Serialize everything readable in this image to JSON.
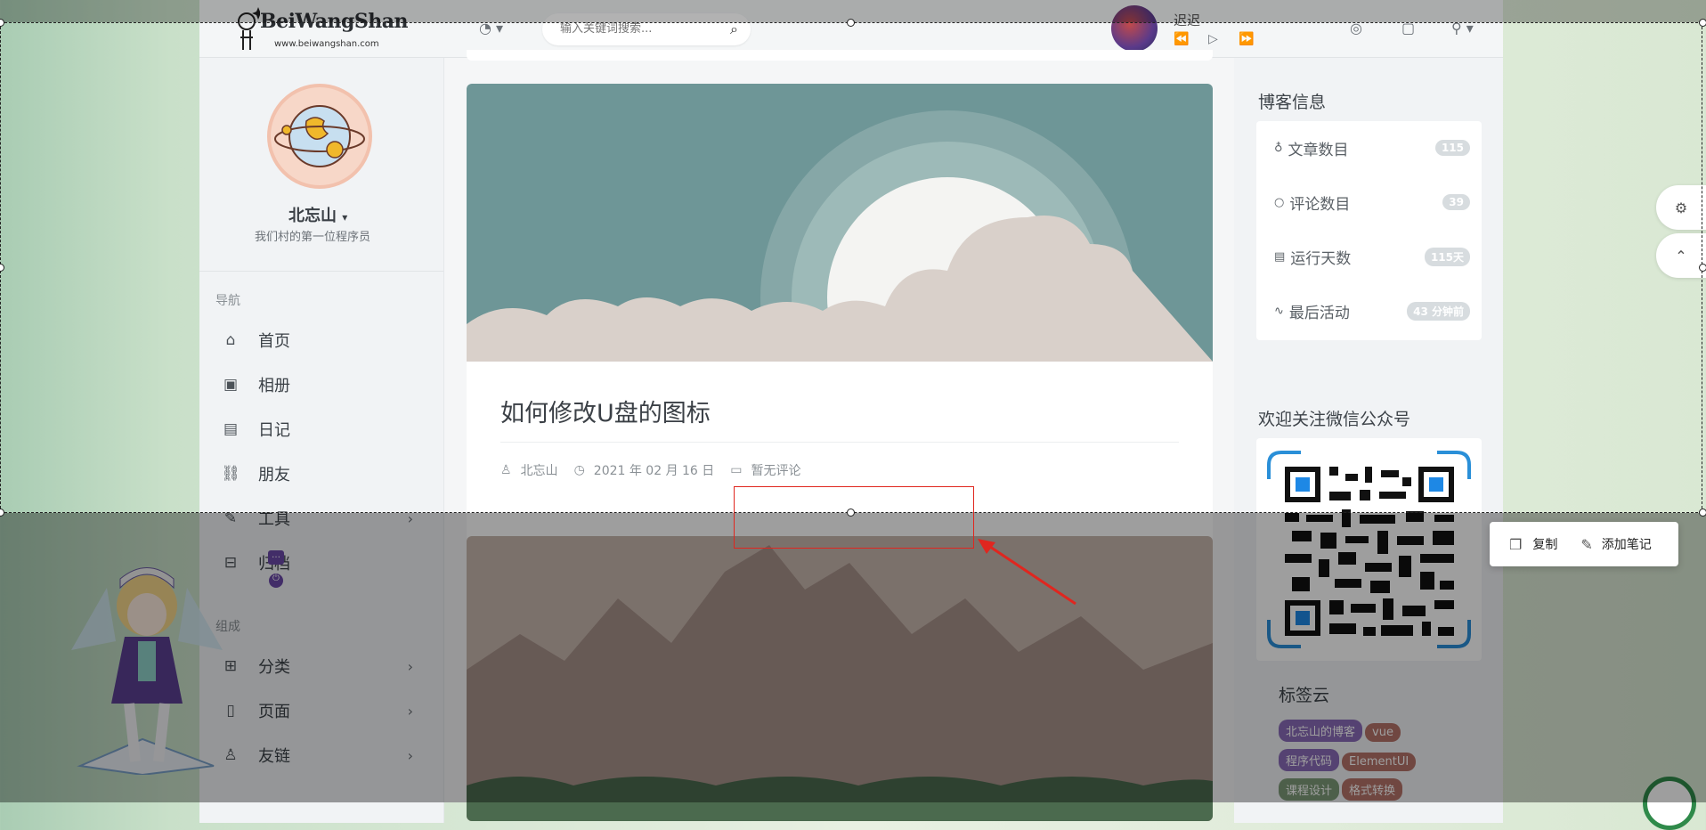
{
  "header": {
    "logo_text": "BeiWangShan",
    "logo_sub": "www.beiwangshan.com",
    "search_placeholder": "输入关键词搜索...",
    "music_status": "迟迟"
  },
  "profile": {
    "name": "北忘山",
    "tagline": "我们村的第一位程序员"
  },
  "nav": {
    "section_label": "导航",
    "items": [
      {
        "label": "首页"
      },
      {
        "label": "相册"
      },
      {
        "label": "日记"
      },
      {
        "label": "朋友"
      },
      {
        "label": "工具"
      },
      {
        "label": "归档"
      }
    ],
    "section2_label": "组成",
    "items2": [
      {
        "label": "分类"
      },
      {
        "label": "页面"
      },
      {
        "label": "友链"
      }
    ]
  },
  "post": {
    "title": "如何修改U盘的图标",
    "author": "北忘山",
    "date": "2021 年 02 月 16 日",
    "comments": "暂无评论"
  },
  "blog_info": {
    "title": "博客信息",
    "rows": [
      {
        "label": "文章数目",
        "value": "115"
      },
      {
        "label": "评论数目",
        "value": "39"
      },
      {
        "label": "运行天数",
        "value": "115天"
      },
      {
        "label": "最后活动",
        "value": "43 分钟前"
      }
    ]
  },
  "wechat": {
    "title": "欢迎关注微信公众号"
  },
  "tag_cloud": {
    "title": "标签云",
    "tags": [
      {
        "label": "北忘山的博客",
        "color": "#8a6bb8"
      },
      {
        "label": "vue",
        "color": "#b5736a"
      },
      {
        "label": "程序代码",
        "color": "#8a6bb8"
      },
      {
        "label": "ElementUI",
        "color": "#b5736a"
      },
      {
        "label": "课程设计",
        "color": "#7c9a78"
      },
      {
        "label": "格式转换",
        "color": "#b5736a"
      }
    ]
  },
  "context_menu": {
    "copy": "复制",
    "add_note": "添加笔记"
  },
  "colors": {
    "annotation_red": "#e0261f",
    "selection_border": "#222222"
  }
}
